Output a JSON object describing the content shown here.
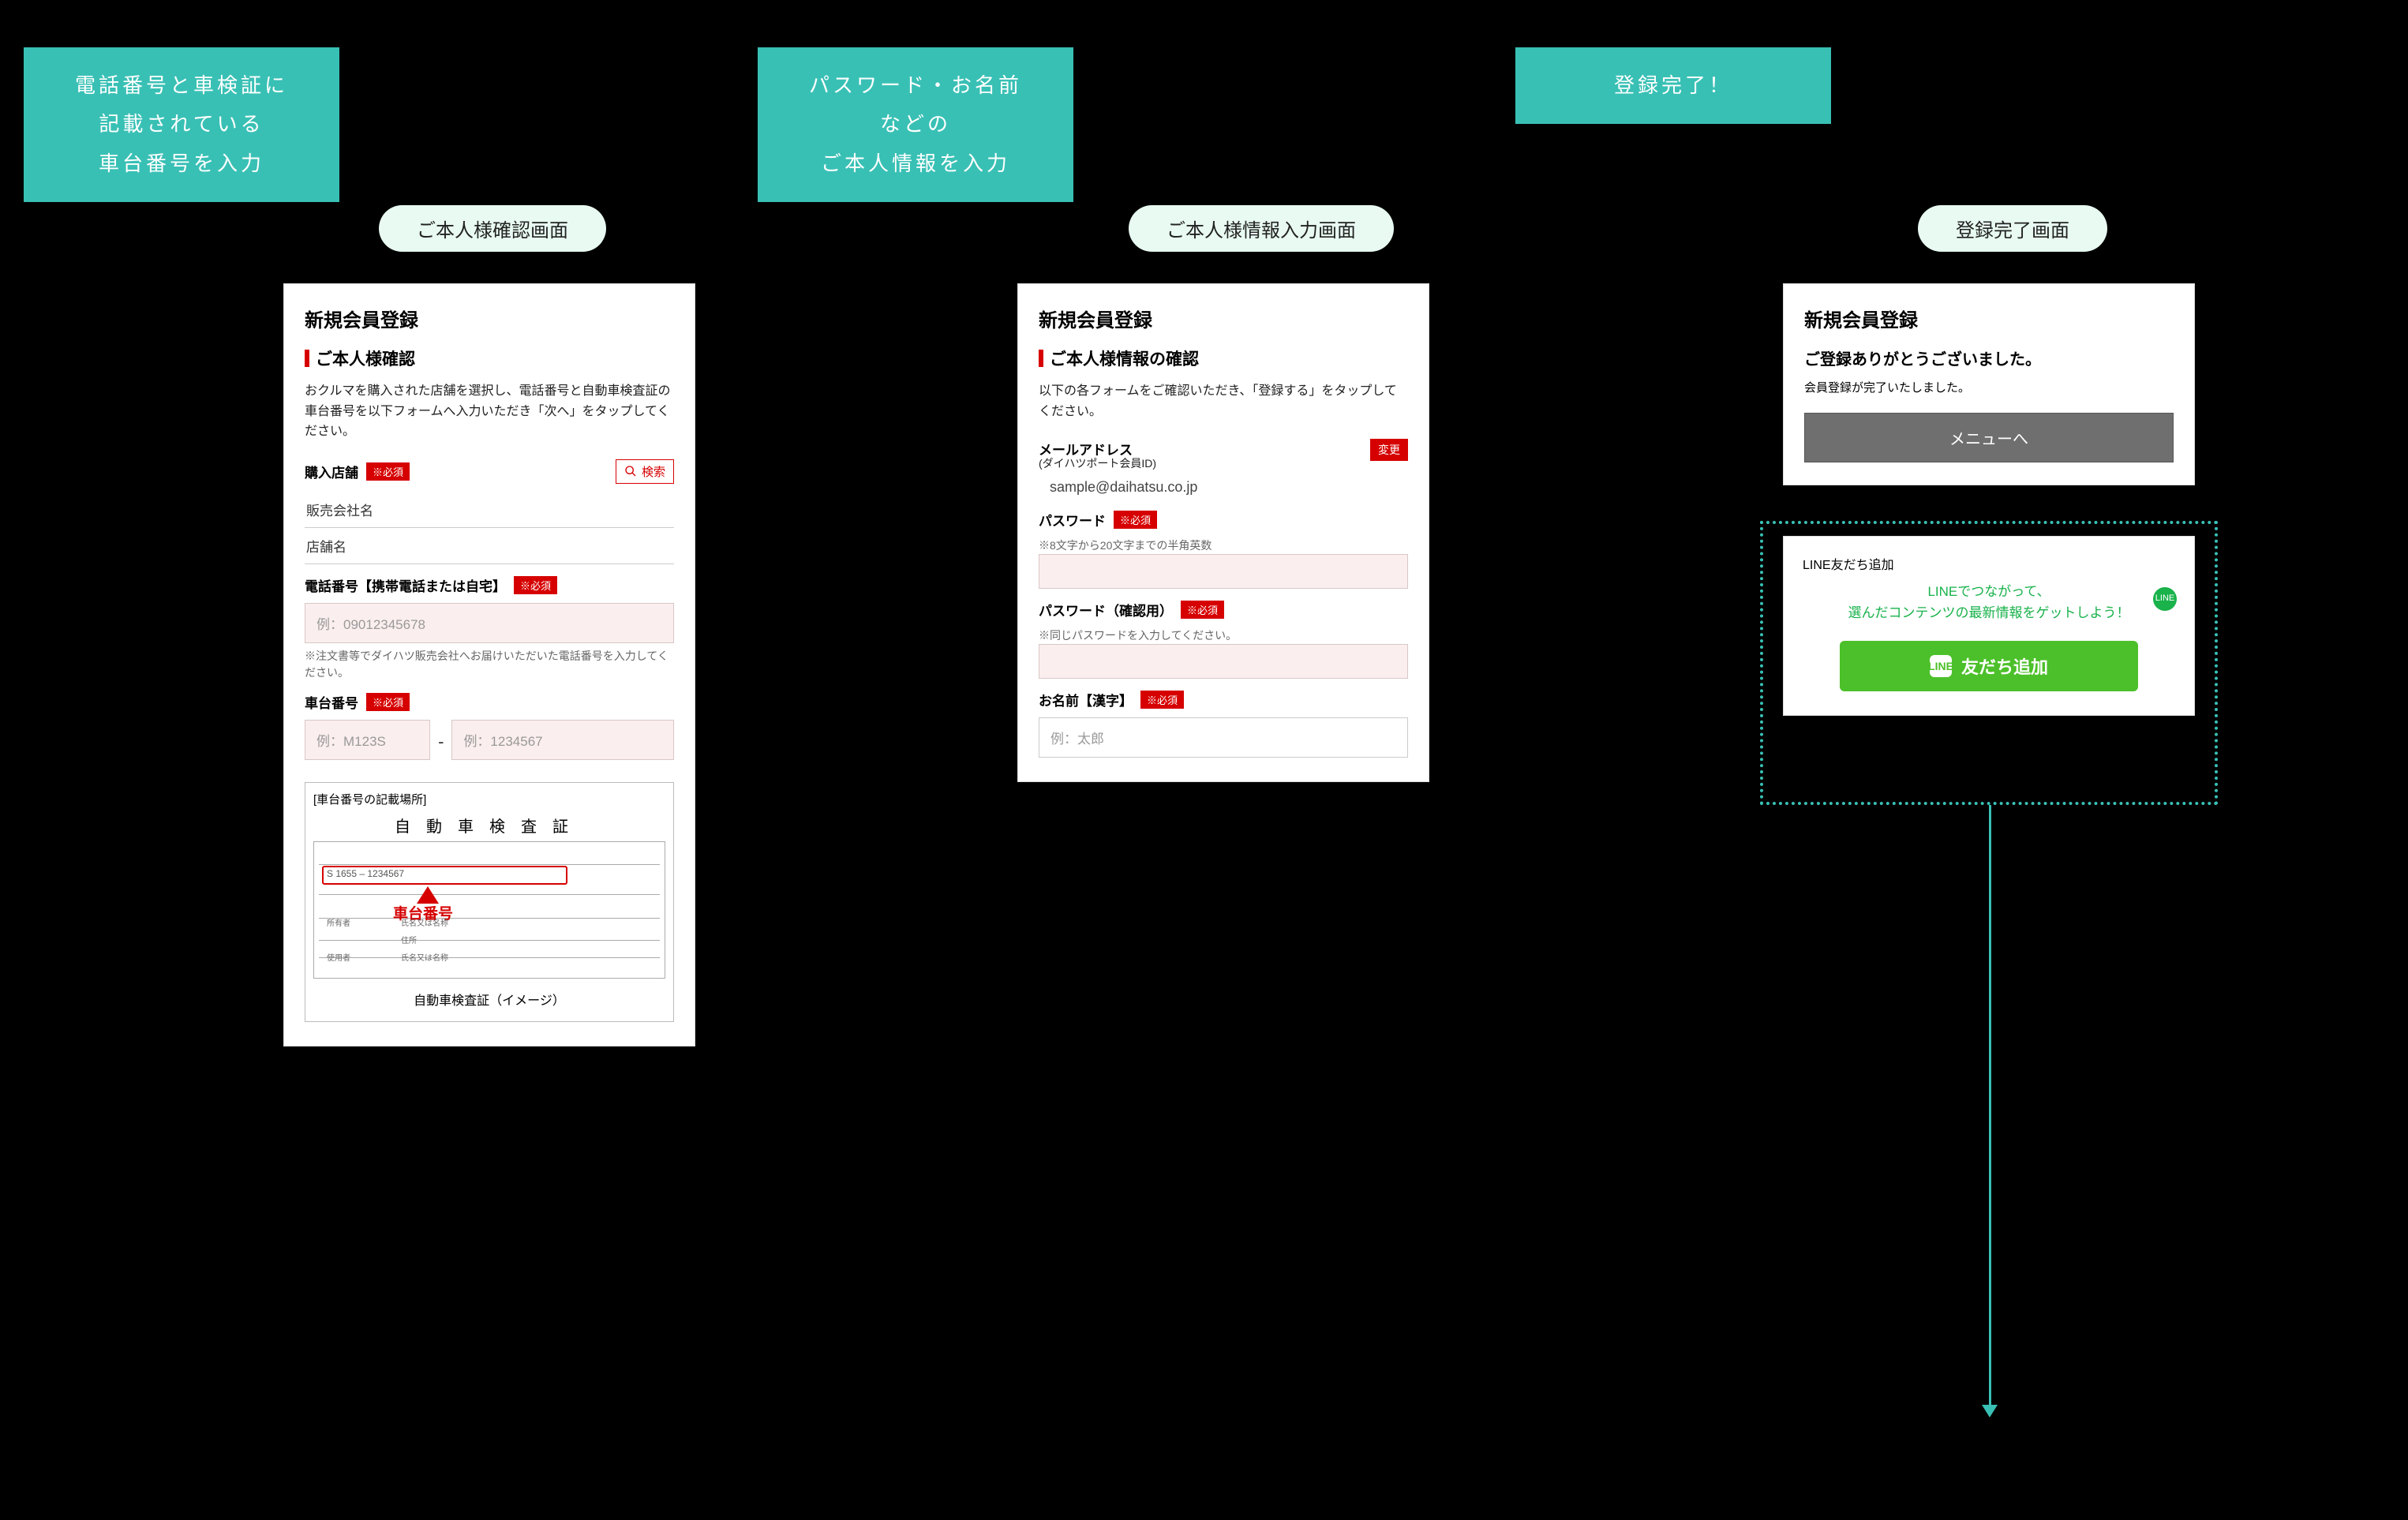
{
  "c1": {
    "teal": "電話番号と車検証に\n記載されている\n車台番号を入力",
    "pill": "ご本人様確認画面",
    "title": "新規会員登録",
    "section": "ご本人様確認",
    "desc": "おクルマを購入された店舗を選択し、電話番号と自動車検査証の車台番号を以下フォームへ入力いただき「次へ」をタップしてください。",
    "store_label": "購入店舗",
    "req": "※必須",
    "search": "検索",
    "company": "販売会社名",
    "shop": "店舗名",
    "phone_label": "電話番号【携帯電話または自宅】",
    "phone_ph": "例：09012345678",
    "phone_note": "※注文書等でダイハツ販売会社へお届けいただいた電話番号を入力してください。",
    "chassis_label": "車台番号",
    "chassis_ph_a": "例：M123S",
    "chassis_sep": "-",
    "chassis_ph_b": "例：1234567",
    "cert_heading": "[車台番号の記載場所]",
    "cert_title": "自動車検査証",
    "cert_sample": "S 1655 – 1234567",
    "cert_arrow_label": "車台番号",
    "cert_s1": "所有者",
    "cert_s2": "",
    "cert_s3": "使用者",
    "cert_s4": "氏名又は名称",
    "cert_s5": "住所",
    "cert_s6": "氏名又は名称",
    "cert_caption": "自動車検査証（イメージ）"
  },
  "c2": {
    "teal": "パスワード・お名前\nなどの\nご本人情報を入力",
    "pill": "ご本人様情報入力画面",
    "title": "新規会員登録",
    "section": "ご本人様情報の確認",
    "desc": "以下の各フォームをご確認いただき、「登録する」をタップしてください。",
    "email_label": "メールアドレス",
    "email_sub": "(ダイハツポート会員ID)",
    "change": "変更",
    "email_val": "sample@daihatsu.co.jp",
    "pw_label": "パスワード",
    "req": "※必須",
    "pw_note": "※8文字から20文字までの半角英数",
    "pw2_label": "パスワード（確認用）",
    "pw2_note": "※同じパスワードを入力してください。",
    "name_label": "お名前【漢字】",
    "name_ph": "例：太郎"
  },
  "c3": {
    "teal": "登録完了！",
    "pill": "登録完了画面",
    "title": "新規会員登録",
    "thanks": "ご登録ありがとうございました。",
    "done": "会員登録が完了いたしました。",
    "menu": "メニューへ",
    "line_section": "LINE友だち追加",
    "line_promo": "LINEでつながって、\n選んだコンテンツの最新情報をゲットしよう！",
    "line_badge": "LINE",
    "line_btn": "友だち追加"
  }
}
